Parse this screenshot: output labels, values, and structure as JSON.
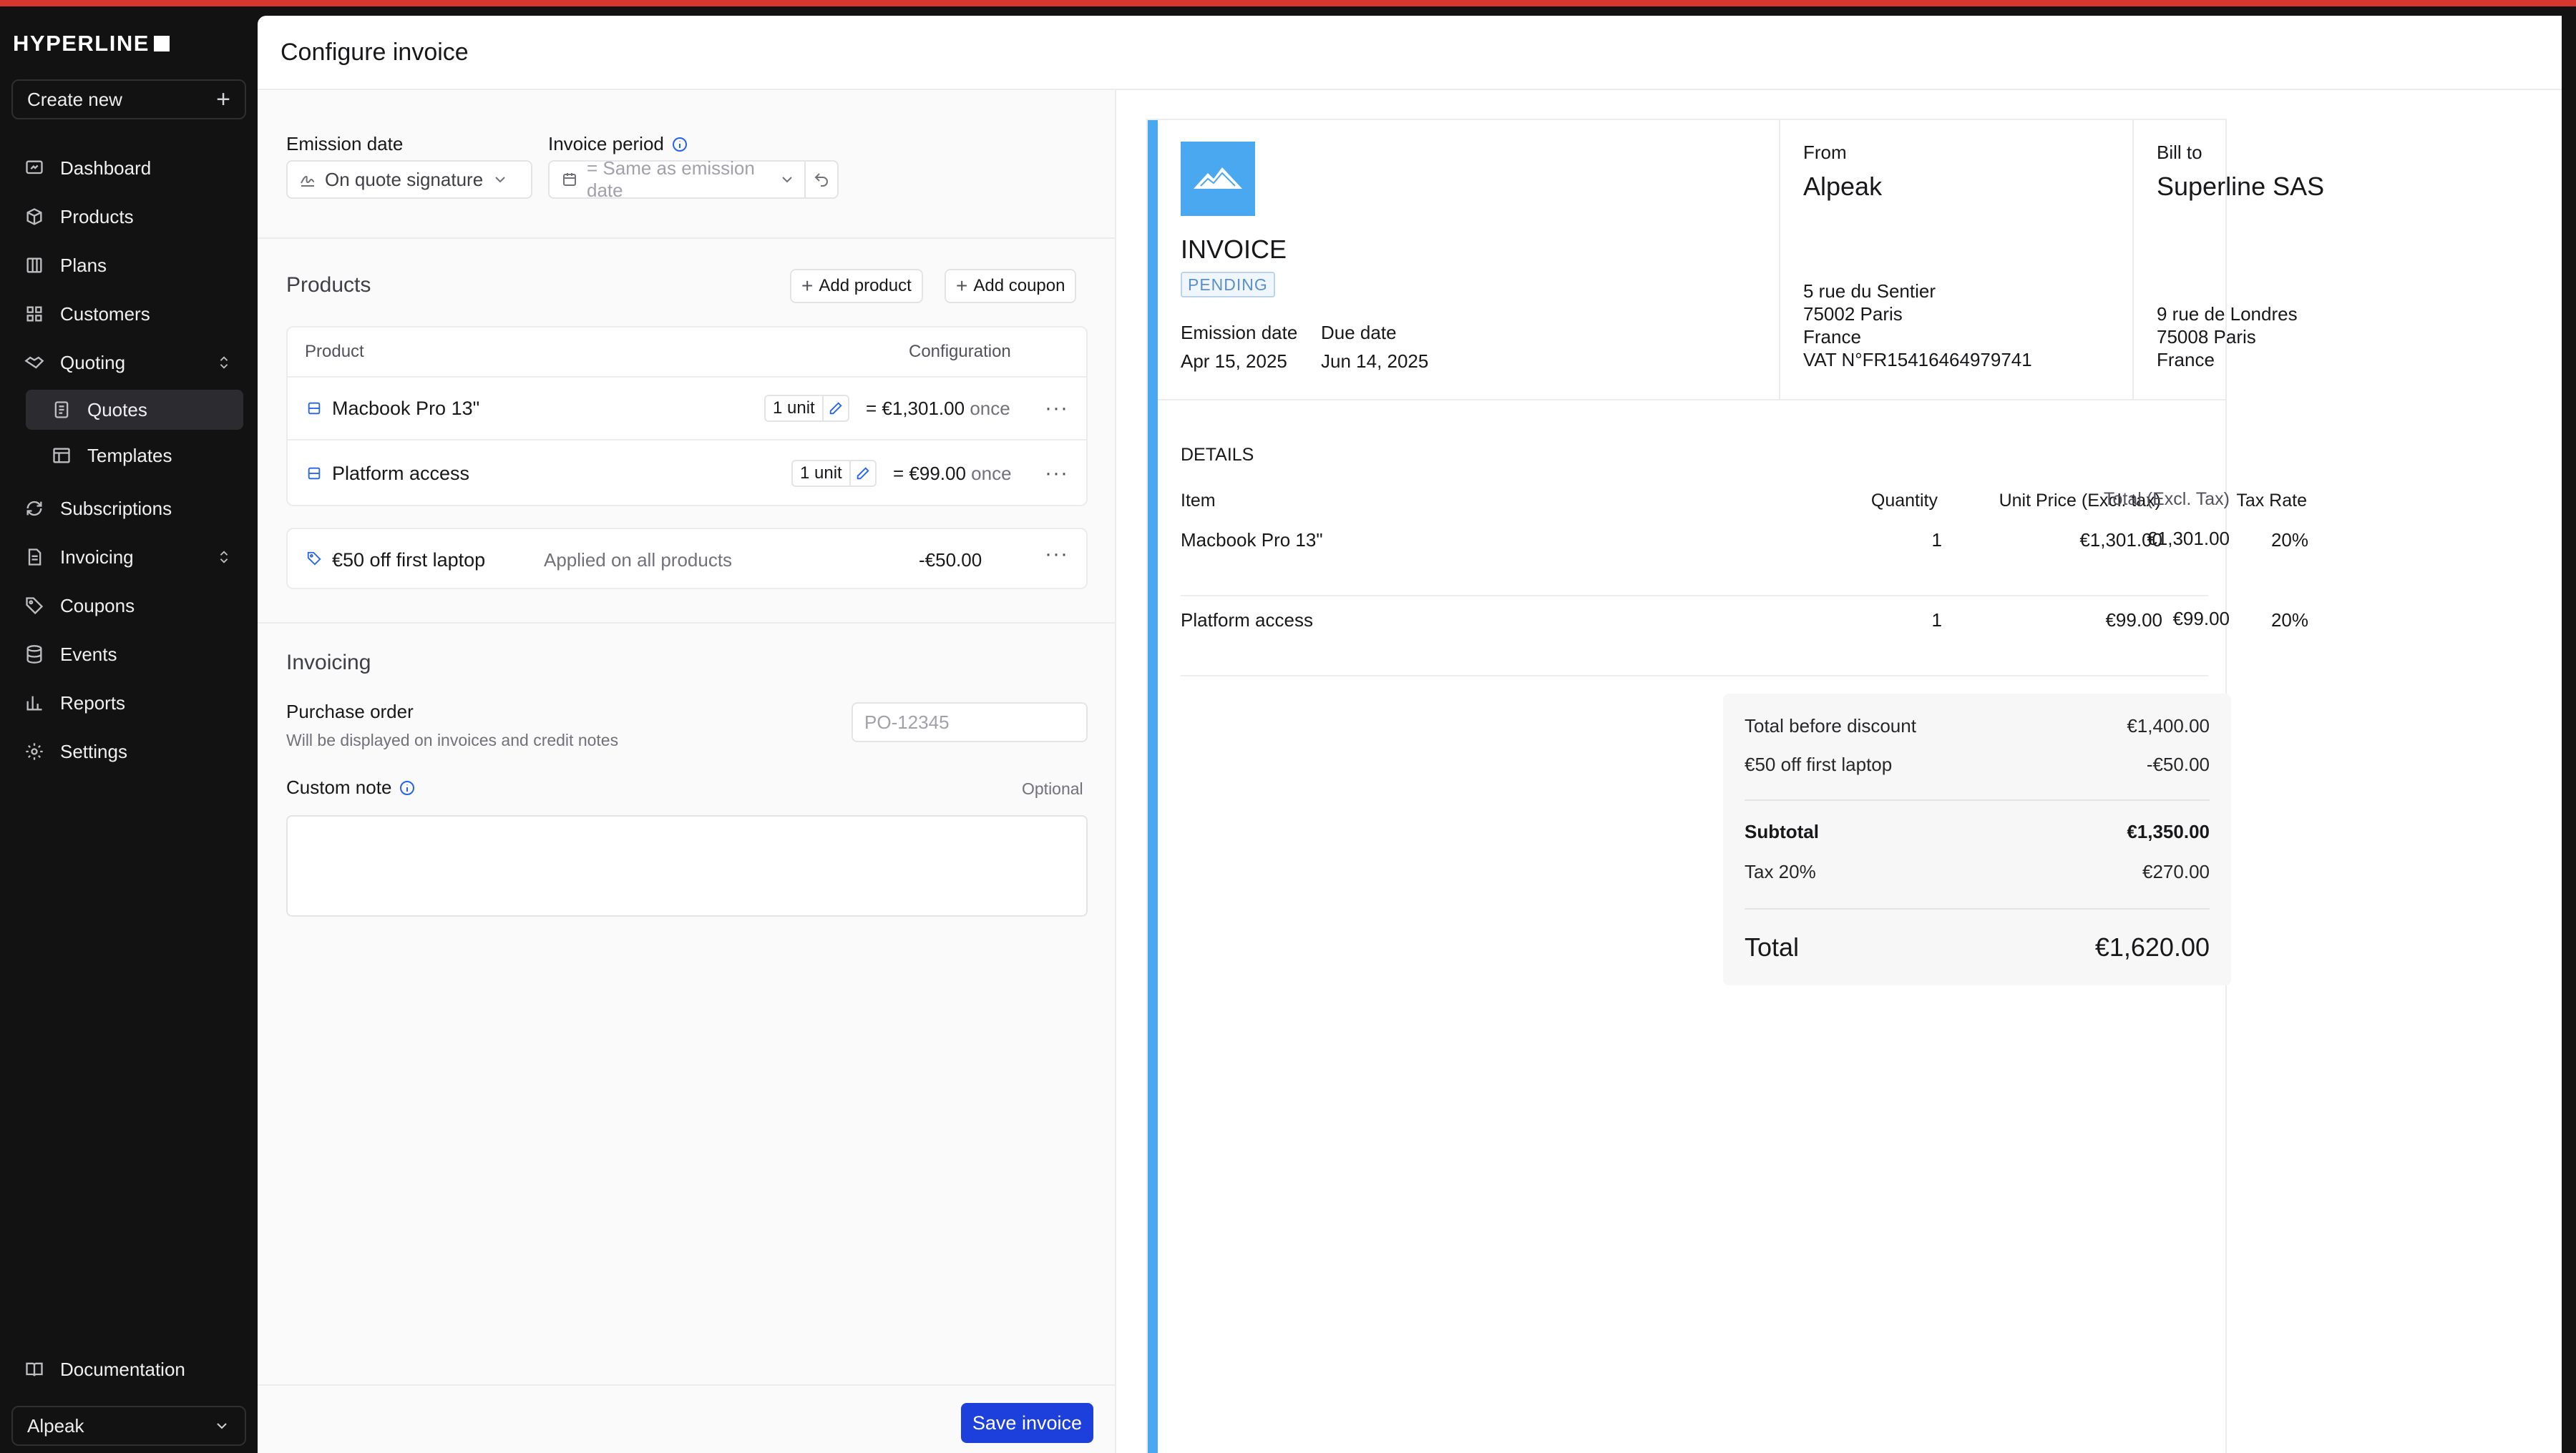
{
  "app": {
    "brand": "HYPERLINE",
    "create_new": "Create new",
    "org": "Alpeak"
  },
  "nav": {
    "dashboard": "Dashboard",
    "products": "Products",
    "plans": "Plans",
    "customers": "Customers",
    "quoting": "Quoting",
    "quotes": "Quotes",
    "templates": "Templates",
    "subscriptions": "Subscriptions",
    "invoicing": "Invoicing",
    "coupons": "Coupons",
    "events": "Events",
    "reports": "Reports",
    "settings": "Settings",
    "documentation": "Documentation"
  },
  "page": {
    "title": "Configure invoice"
  },
  "config": {
    "emission_date_label": "Emission date",
    "emission_date_value": "On quote signature",
    "invoice_period_label": "Invoice period",
    "invoice_period_value": "= Same as emission date",
    "products_title": "Products",
    "add_product": "Add product",
    "add_coupon": "Add coupon",
    "col_product": "Product",
    "col_configuration": "Configuration",
    "products": [
      {
        "name": "Macbook Pro 13\"",
        "qty": "1 unit",
        "price": "= €1,301.00",
        "freq": "once"
      },
      {
        "name": "Platform access",
        "qty": "1 unit",
        "price": "= €99.00",
        "freq": "once"
      }
    ],
    "coupon": {
      "name": "€50 off first laptop",
      "scope": "Applied on all products",
      "amount": "-€50.00"
    },
    "invoicing_title": "Invoicing",
    "po_label": "Purchase order",
    "po_hint": "Will be displayed on invoices and credit notes",
    "po_placeholder": "PO-12345",
    "note_label": "Custom note",
    "note_optional": "Optional",
    "save": "Save invoice"
  },
  "invoice": {
    "title": "INVOICE",
    "status": "PENDING",
    "emission_label": "Emission date",
    "emission_value": "Apr 15, 2025",
    "due_label": "Due date",
    "due_value": "Jun 14, 2025",
    "from_label": "From",
    "from_name": "Alpeak",
    "from_address": [
      "5 rue du Sentier",
      "75002 Paris",
      "France",
      "VAT N°FR15416464979741"
    ],
    "bill_label": "Bill to",
    "bill_name": "Superline SAS",
    "bill_address": [
      "9 rue de Londres",
      "75008 Paris",
      "France"
    ],
    "details_title": "DETAILS",
    "headers": {
      "item": "Item",
      "quantity": "Quantity",
      "unit_price": "Unit Price (Excl. tax)",
      "tax_rate": "Tax Rate",
      "total": "Total (Excl. Tax)"
    },
    "lines": [
      {
        "item": "Macbook Pro 13\"",
        "quantity": "1",
        "unit_price": "€1,301.00",
        "tax_rate": "20%",
        "total": "€1,301.00"
      },
      {
        "item": "Platform access",
        "quantity": "1",
        "unit_price": "€99.00",
        "tax_rate": "20%",
        "total": "€99.00"
      }
    ],
    "totals": {
      "before_discount_label": "Total before discount",
      "before_discount_value": "€1,400.00",
      "discount_label": "€50 off first laptop",
      "discount_value": "-€50.00",
      "subtotal_label": "Subtotal",
      "subtotal_value": "€1,350.00",
      "tax_label": "Tax 20%",
      "tax_value": "€270.00",
      "total_label": "Total",
      "total_value": "€1,620.00"
    }
  },
  "colors": {
    "accent": "#1d3fdb",
    "invoice_brand": "#4aa8f0",
    "top_banner": "#d7362e"
  }
}
